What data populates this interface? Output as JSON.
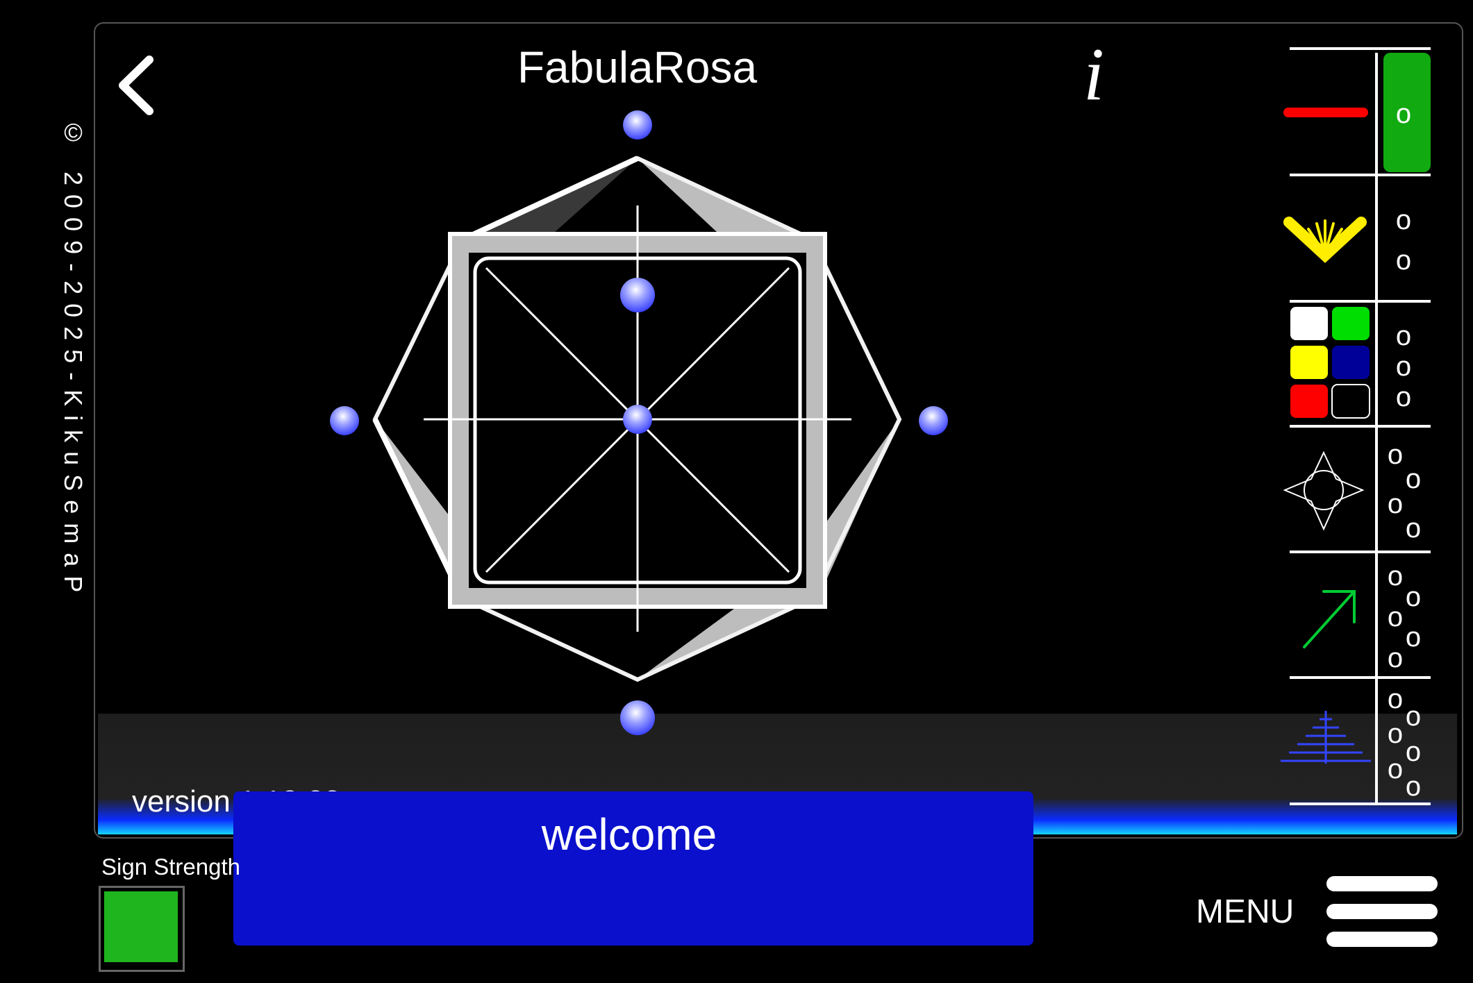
{
  "copyright": "© 2009-2025-KikuSemaP",
  "header": {
    "title": "FabulaRosa",
    "info_label": "i"
  },
  "version": "version 1.13.23",
  "welcome": "welcome",
  "sign_strength": {
    "label": "Sign Strength",
    "value_color": "#1fb51f"
  },
  "menu": {
    "label": "MENU"
  },
  "toolbar": {
    "tools": [
      {
        "name": "line-tool",
        "color": "#ff0000",
        "count": 1,
        "selected": true
      },
      {
        "name": "sparkle-tool",
        "color": "#ffee00",
        "count": 2
      },
      {
        "name": "color-palette",
        "count": 3,
        "colors": [
          "#ffffff",
          "#00dd00",
          "#ffff00",
          "#000099",
          "#ff0000",
          "#000000"
        ]
      },
      {
        "name": "compass-star-tool",
        "count": 4
      },
      {
        "name": "arrow-tool",
        "color": "#00cc33",
        "count": 5
      },
      {
        "name": "pyramid-tool",
        "color": "#2233cc",
        "count": 6
      }
    ],
    "tick_glyph": "o",
    "selected_color": "#11aa11"
  },
  "colors": {
    "background": "#000000",
    "banner": "#0a10cc",
    "node": "#7c84ff"
  }
}
